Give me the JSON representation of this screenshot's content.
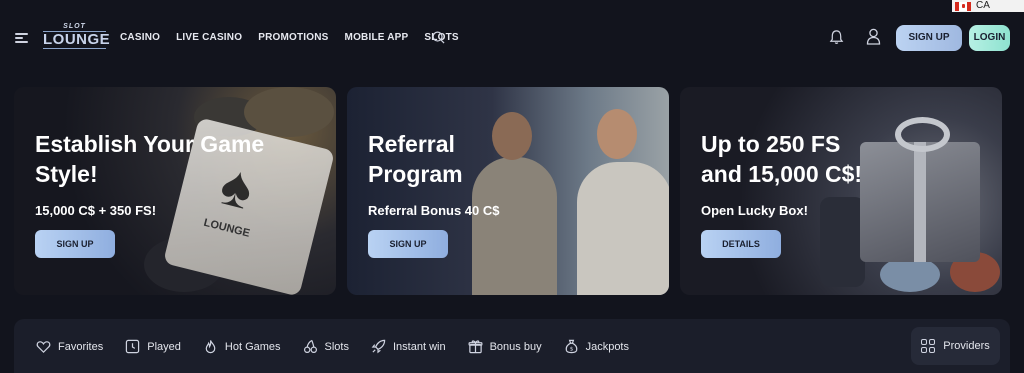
{
  "locale": {
    "code": "CA",
    "flag_icon": "canada-flag-icon"
  },
  "header": {
    "logo_top": "SLOT",
    "logo_main": "LOUNGE",
    "nav": [
      "CASINO",
      "LIVE CASINO",
      "PROMOTIONS",
      "MOBILE APP",
      "SLOTS"
    ],
    "signup_label": "SIGN UP",
    "login_label": "LOGIN"
  },
  "banners": [
    {
      "title_line1": "Establish Your Game",
      "title_line2": "Style!",
      "subtitle": "15,000 C$ + 350 FS!",
      "cta": "SIGN UP"
    },
    {
      "title_line1": "Referral",
      "title_line2": "Program",
      "subtitle": "Referral Bonus 40 C$",
      "cta": "SIGN UP"
    },
    {
      "title_line1": "Up to 250 FS",
      "title_line2": "and 15,000 C$!",
      "subtitle": "Open Lucky Box!",
      "cta": "DETAILS"
    }
  ],
  "filters": [
    {
      "label": "Favorites",
      "icon": "heart-icon"
    },
    {
      "label": "Played",
      "icon": "clock-icon"
    },
    {
      "label": "Hot Games",
      "icon": "flame-icon"
    },
    {
      "label": "Slots",
      "icon": "cherries-icon"
    },
    {
      "label": "Instant win",
      "icon": "rocket-icon"
    },
    {
      "label": "Bonus buy",
      "icon": "gift-icon"
    },
    {
      "label": "Jackpots",
      "icon": "money-bag-icon"
    }
  ],
  "providers_label": "Providers",
  "colors": {
    "background": "#12141d",
    "accent_blue": "#b9d2f3",
    "accent_mint": "#8ee2cf"
  }
}
